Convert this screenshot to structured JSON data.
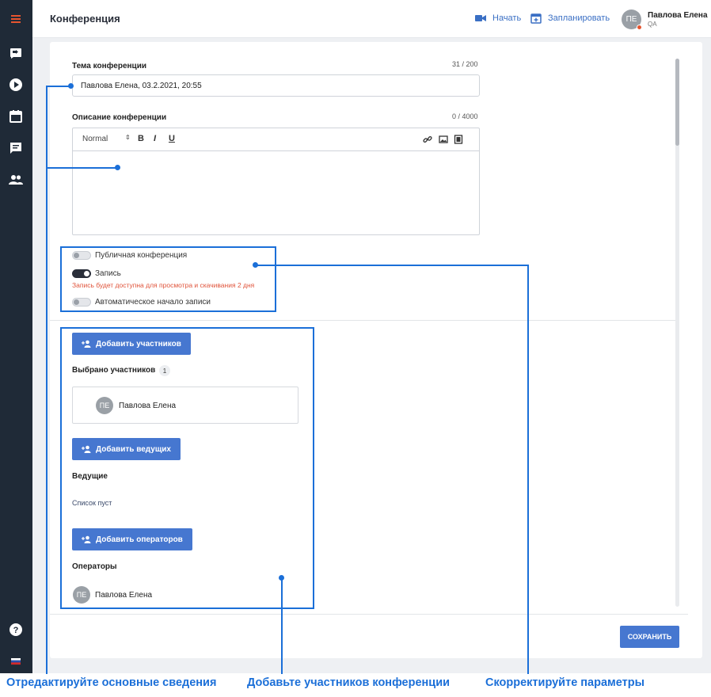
{
  "header": {
    "title": "Конференция",
    "start_label": "Начать",
    "schedule_label": "Запланировать",
    "user_initials": "ПЕ",
    "user_name": "Павлова Елена",
    "user_role": "QA"
  },
  "sidebar": {
    "items": [
      "menu-icon",
      "video-camera-icon",
      "play-icon",
      "calendar-icon",
      "chat-icon",
      "users-icon",
      "help-icon",
      "flag-icon"
    ]
  },
  "form": {
    "topic_label": "Тема конференции",
    "topic_counter": "31 / 200",
    "topic_value": "Павлова Елена, 03.2.2021, 20:55",
    "description_label": "Описание конференции",
    "description_counter": "0 / 4000",
    "editor_format": "Normal",
    "editor_bold": "B",
    "editor_italic": "I",
    "editor_underline": "U",
    "public_label": "Публичная конференция",
    "public_on": false,
    "record_label": "Запись",
    "record_on": true,
    "record_warning": "Запись будет доступна для просмотра и скачивания 2 дня",
    "autorecord_label": "Автоматическое начало записи",
    "autorecord_on": false
  },
  "participants": {
    "add_participants_label": "Добавить участников",
    "selected_label": "Выбрано участников",
    "selected_count": "1",
    "participant_initials": "ПЕ",
    "participant_name": "Павлова Елена",
    "add_hosts_label": "Добавить ведущих",
    "hosts_label": "Ведущие",
    "hosts_empty": "Список пуст",
    "add_operators_label": "Добавить операторов",
    "operators_label": "Операторы",
    "operator_initials": "ПЕ",
    "operator_name": "Павлова Елена"
  },
  "save_label": "СОХРАНИТЬ",
  "annotations": {
    "edit_info": "Отредактируйте основные сведения",
    "add_participants": "Добавьте участников конференции",
    "adjust_params": "Скорректируйте параметры"
  },
  "colors": {
    "accent": "#4677d0",
    "sidebar": "#1f2a37",
    "annotation": "#1b6fd8",
    "warning": "#e0533a"
  }
}
